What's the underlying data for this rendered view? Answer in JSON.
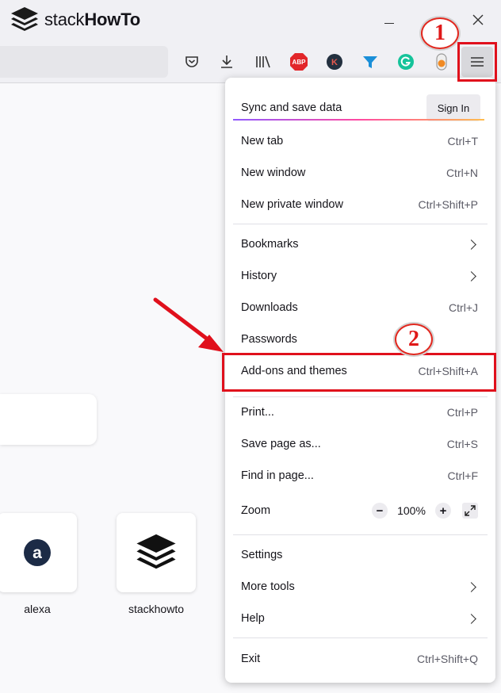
{
  "logo": {
    "text_regular": "stack",
    "text_bold": "HowTo"
  },
  "toolbar": {
    "icons": [
      "pocket-icon",
      "download-icon",
      "library-icon",
      "adblock-plus-icon",
      "k-extension-icon",
      "funnel-extension-icon",
      "grammarly-icon",
      "extension-toggle-icon",
      "hamburger-menu-icon"
    ],
    "abp_label": "ABP",
    "k_label": "K"
  },
  "annotations": {
    "badge1": "1",
    "badge2": "2"
  },
  "new_tab": {
    "shortcuts": [
      {
        "label": "alexa",
        "icon_letter": "a"
      },
      {
        "label": "stackhowto"
      }
    ]
  },
  "menu": {
    "sync_label": "Sync and save data",
    "sign_in": "Sign In",
    "items": [
      {
        "label": "New tab",
        "shortcut": "Ctrl+T"
      },
      {
        "label": "New window",
        "shortcut": "Ctrl+N"
      },
      {
        "label": "New private window",
        "shortcut": "Ctrl+Shift+P"
      },
      {
        "label": "Bookmarks"
      },
      {
        "label": "History"
      },
      {
        "label": "Downloads",
        "shortcut": "Ctrl+J"
      },
      {
        "label": "Passwords"
      },
      {
        "label": "Add-ons and themes",
        "shortcut": "Ctrl+Shift+A"
      },
      {
        "label": "Print...",
        "shortcut": "Ctrl+P"
      },
      {
        "label": "Save page as...",
        "shortcut": "Ctrl+S"
      },
      {
        "label": "Find in page...",
        "shortcut": "Ctrl+F"
      },
      {
        "label": "Zoom"
      },
      {
        "label": "Settings"
      },
      {
        "label": "More tools"
      },
      {
        "label": "Help"
      },
      {
        "label": "Exit",
        "shortcut": "Ctrl+Shift+Q"
      }
    ],
    "zoom": {
      "minus": "−",
      "value": "100%",
      "plus": "+"
    }
  },
  "colors": {
    "accent_red": "#e0101c",
    "menu_bg": "#ffffff",
    "toolbar_bg": "#f0f0f4"
  }
}
